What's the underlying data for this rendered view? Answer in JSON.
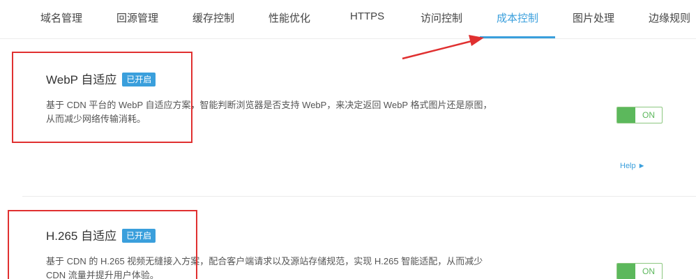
{
  "tabs": [
    {
      "label": "域名管理"
    },
    {
      "label": "回源管理"
    },
    {
      "label": "缓存控制"
    },
    {
      "label": "性能优化"
    },
    {
      "label": "HTTPS"
    },
    {
      "label": "访问控制"
    },
    {
      "label": "成本控制",
      "active": true
    },
    {
      "label": "图片处理"
    },
    {
      "label": "边缘规则"
    }
  ],
  "features": [
    {
      "title": "WebP 自适应",
      "badge": "已开启",
      "description": "基于 CDN 平台的 WebP 自适应方案，智能判断浏览器是否支持 WebP，来决定返回 WebP 格式图片还是原图，从而减少网络传输消耗。",
      "switch_label": "ON",
      "help_label": "Help ►"
    },
    {
      "title": "H.265 自适应",
      "badge": "已开启",
      "description": "基于 CDN 的 H.265 视频无缝接入方案，配合客户端请求以及源站存储规范，实现 H.265 智能适配，从而减少 CDN 流量并提升用户体验。",
      "switch_label": "ON"
    }
  ],
  "colors": {
    "accent": "#3a9fdc",
    "switch_on": "#5cb85c",
    "annotation": "#e03030"
  }
}
